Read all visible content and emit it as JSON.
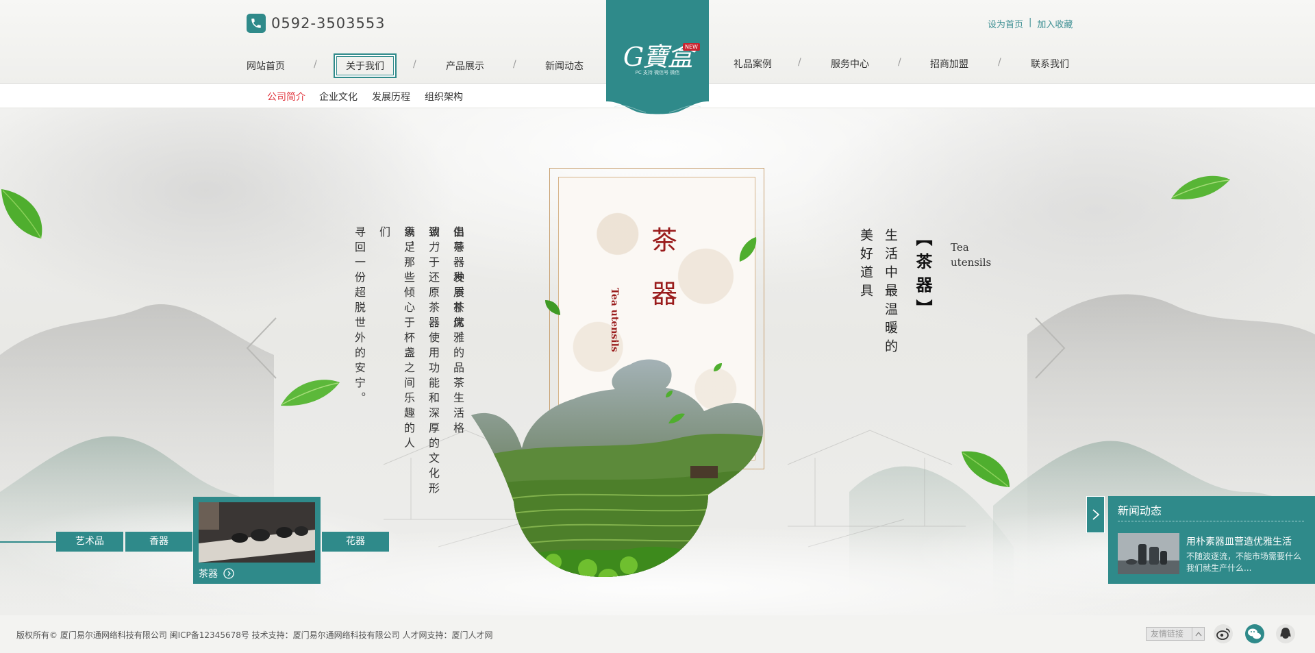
{
  "header": {
    "phone": "0592-3503553",
    "top_links": {
      "set_home": "设为首页",
      "separator": "|",
      "add_favorite": "加入收藏"
    },
    "nav_left": [
      "网站首页",
      "关于我们",
      "产品展示",
      "新闻动态"
    ],
    "nav_right": [
      "礼品案例",
      "服务中心",
      "招商加盟",
      "联系我们"
    ],
    "nav_separator": "/",
    "active_nav": "关于我们",
    "logo": {
      "text": "G寶盒",
      "badge": "NEW",
      "sub": "PC 支持 微信号 微信"
    }
  },
  "subnav": {
    "items": [
      "公司简介",
      "企业文化",
      "发展历程",
      "组织架构"
    ],
    "current": "公司简介"
  },
  "hero": {
    "card_title": "茶器",
    "card_title_top": "茶",
    "card_title_bottom": "器",
    "card_en": "Tea utensils",
    "left_text_columns": [
      "由茶器发展茶席，",
      "倡导一种质朴优雅的品茶生活格调。",
      "致力于还原茶器使用功能和深厚的文化形象，",
      "满足那些倾心于杯盏之间乐趣的人们",
      "寻回一份超脱世外的安宁。"
    ],
    "slogan_col1": "生活中最温暖的",
    "slogan_col2": "美好道具",
    "slogan_bracket": "【茶器】",
    "slogan_en_line1": "Tea",
    "slogan_en_line2": "utensils"
  },
  "categories": {
    "tabs": [
      "艺术品",
      "香器",
      "花器"
    ],
    "featured": "茶器"
  },
  "news": {
    "title": "新闻动态",
    "headline": "用朴素器皿营造优雅生活",
    "summary": "不随波逐流，不能市场需要什么我们就生产什么..."
  },
  "footer": {
    "copyright": "版权所有© 厦门易尔通网络科技有限公司   闽ICP备12345678号   技术支持：厦门易尔通网络科技有限公司   人才网支持：厦门人才网",
    "friend_links": "友情链接",
    "social": [
      "weibo-icon",
      "wechat-icon",
      "qq-icon"
    ]
  },
  "colors": {
    "accent": "#2f8a8a",
    "highlight": "#e0343c",
    "title_red": "#9a1c1c"
  }
}
